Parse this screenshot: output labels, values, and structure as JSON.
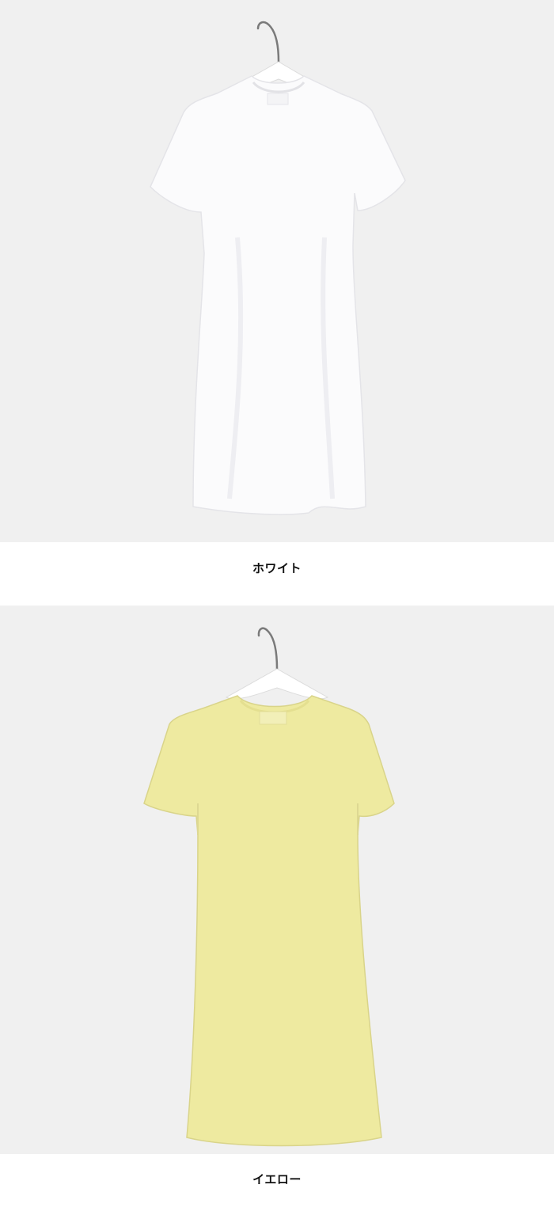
{
  "products": [
    {
      "color_name": "ホワイト",
      "dress_color": "#fbfbfc",
      "dress_shadow": "#e4e4e8"
    },
    {
      "color_name": "イエロー",
      "dress_color": "#eeeaa0",
      "dress_shadow": "#d9d48a"
    }
  ],
  "background_color": "#f0f0f0",
  "hanger": {
    "hook_color": "#7a7a7a",
    "body_color": "#ffffff"
  }
}
